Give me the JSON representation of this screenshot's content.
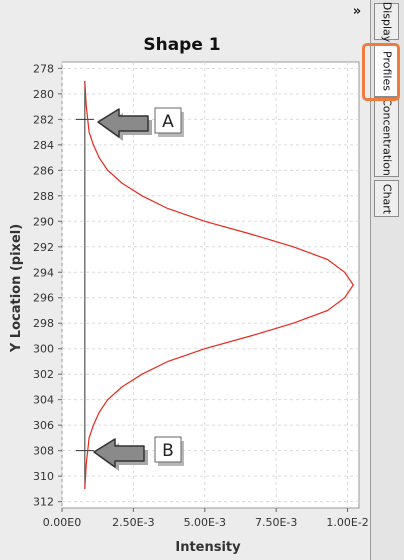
{
  "header": {
    "title": "Shape 1"
  },
  "sidebar": {
    "collapse_label": "»",
    "tabs": [
      {
        "label": "Display",
        "selected": false
      },
      {
        "label": "Profiles",
        "selected": true
      },
      {
        "label": "Concentration",
        "selected": false
      },
      {
        "label": "Chart",
        "selected": false
      }
    ],
    "highlight_color": "#f07b3f"
  },
  "annotations": {
    "marker_a": "A",
    "marker_b": "B"
  },
  "chart_data": {
    "type": "line",
    "title": "Shape 1",
    "xlabel": "Intensity",
    "ylabel": "Y Location (pixel)",
    "xlim": [
      0,
      0.0104
    ],
    "ylim": [
      277.5,
      312.5
    ],
    "y_inverted": true,
    "grid": true,
    "x_ticks": [
      0,
      0.0025,
      0.005,
      0.0075,
      0.01
    ],
    "x_tick_labels": [
      "0.00E0",
      "2.50E-3",
      "5.00E-3",
      "7.50E-3",
      "1.00E-2"
    ],
    "y_ticks": [
      278,
      280,
      282,
      284,
      286,
      288,
      290,
      292,
      294,
      296,
      298,
      300,
      302,
      304,
      306,
      308,
      310,
      312
    ],
    "baseline_x": 0.0008,
    "series": [
      {
        "color": "#e8291c",
        "points": [
          [
            0.0008,
            279
          ],
          [
            0.00085,
            281
          ],
          [
            0.0009,
            282
          ],
          [
            0.00095,
            283
          ],
          [
            0.0011,
            284
          ],
          [
            0.0013,
            285
          ],
          [
            0.0016,
            286
          ],
          [
            0.0021,
            287
          ],
          [
            0.0028,
            288
          ],
          [
            0.0037,
            289
          ],
          [
            0.005,
            290
          ],
          [
            0.0066,
            291
          ],
          [
            0.0081,
            292
          ],
          [
            0.0093,
            293
          ],
          [
            0.0099,
            294
          ],
          [
            0.0102,
            295
          ],
          [
            0.0099,
            296
          ],
          [
            0.0093,
            297
          ],
          [
            0.0081,
            298
          ],
          [
            0.0066,
            299
          ],
          [
            0.005,
            300
          ],
          [
            0.0037,
            301
          ],
          [
            0.0028,
            302
          ],
          [
            0.0021,
            303
          ],
          [
            0.0016,
            304
          ],
          [
            0.0013,
            305
          ],
          [
            0.0011,
            306
          ],
          [
            0.00095,
            307
          ],
          [
            0.0009,
            308
          ],
          [
            0.00085,
            309
          ],
          [
            0.0008,
            311
          ]
        ]
      }
    ],
    "markers": [
      {
        "label": "A",
        "y": 282
      },
      {
        "label": "B",
        "y": 308
      }
    ]
  }
}
